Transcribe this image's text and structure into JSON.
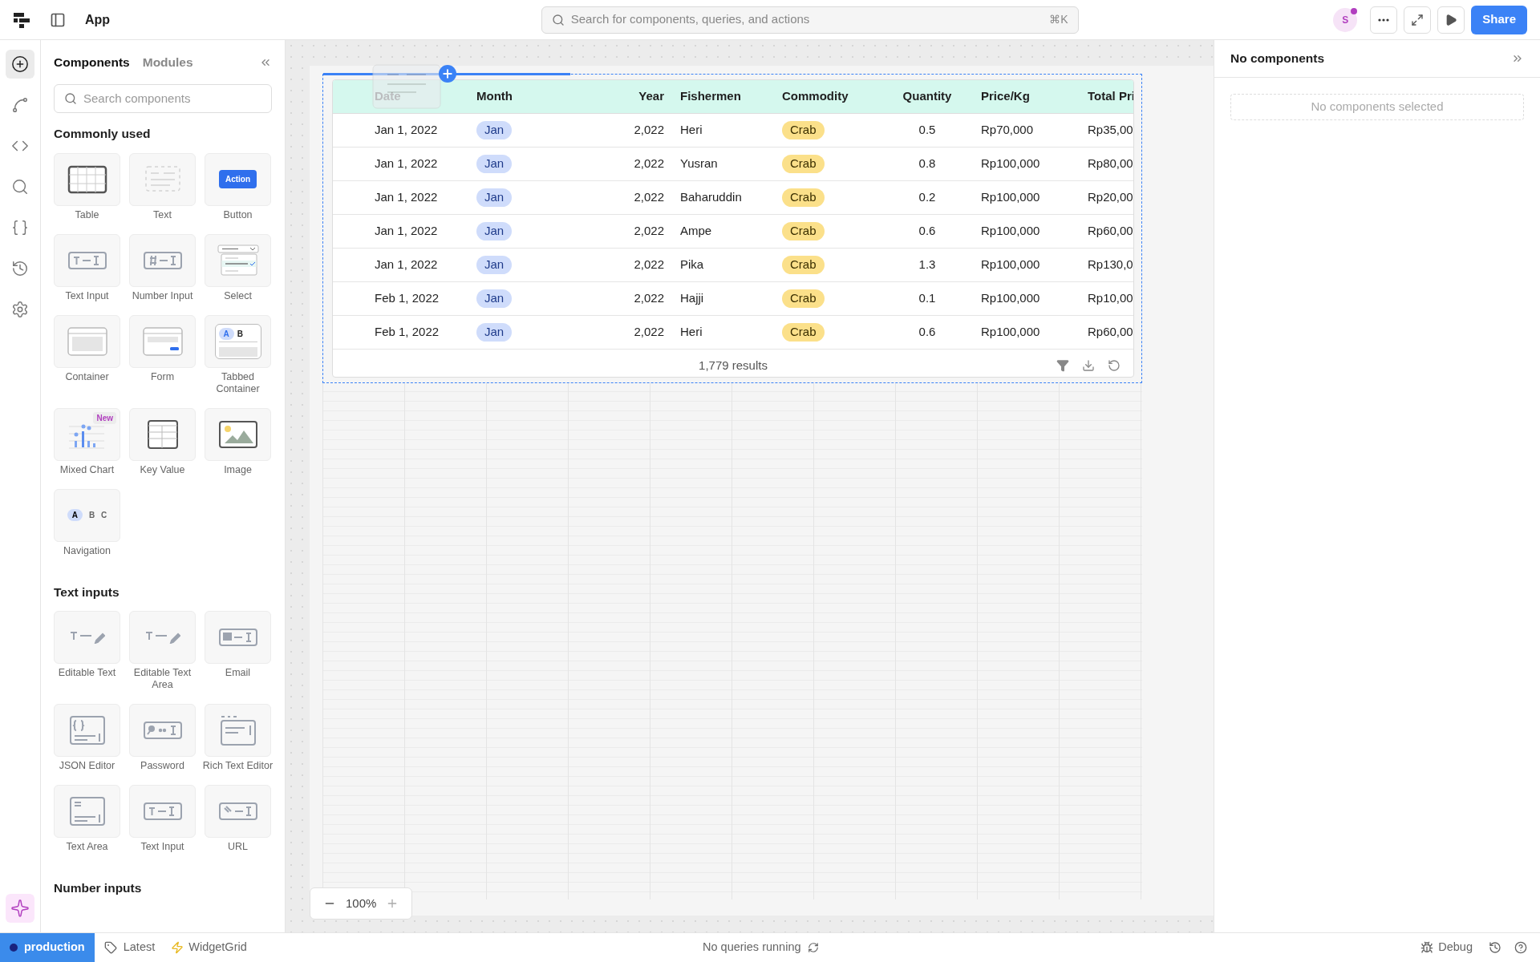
{
  "topbar": {
    "app_name": "App",
    "search": {
      "placeholder": "Search for components, queries, and actions",
      "shortcut": "⌘K"
    },
    "avatar": "S",
    "share": "Share"
  },
  "rail": [
    {
      "kind": "add",
      "selected": true
    },
    {
      "kind": "workflow",
      "selected": false
    },
    {
      "kind": "code",
      "selected": false
    },
    {
      "kind": "search",
      "selected": false
    },
    {
      "kind": "state",
      "selected": false
    },
    {
      "kind": "history",
      "selected": false
    },
    {
      "kind": "settings",
      "selected": false
    }
  ],
  "panel": {
    "tabs": [
      {
        "label": "Components",
        "selected": true
      },
      {
        "label": "Modules",
        "selected": false
      }
    ],
    "search": {
      "placeholder": "Search components"
    },
    "sections": [
      {
        "title": "Commonly used",
        "items": [
          {
            "label": "Table",
            "kind": "table"
          },
          {
            "label": "Text",
            "kind": "text"
          },
          {
            "label": "Button",
            "kind": "button",
            "preview": [
              "Action"
            ]
          },
          {
            "label": "Text Input",
            "kind": "text-input"
          },
          {
            "label": "Number Input",
            "kind": "number-input"
          },
          {
            "label": "Select",
            "kind": "select"
          },
          {
            "label": "Container",
            "kind": "container"
          },
          {
            "label": "Form",
            "kind": "form"
          },
          {
            "label": "Tabbed Container",
            "kind": "tabbed",
            "preview": [
              "A",
              "B"
            ]
          },
          {
            "label": "Mixed Chart",
            "kind": "chart",
            "badge": "New"
          },
          {
            "label": "Key Value",
            "kind": "key-value"
          },
          {
            "label": "Image",
            "kind": "image"
          },
          {
            "label": "Navigation",
            "kind": "navigation",
            "preview": [
              "A",
              "B",
              "C"
            ]
          }
        ]
      },
      {
        "title": "Text inputs",
        "items": [
          {
            "label": "Editable Text",
            "kind": "editable"
          },
          {
            "label": "Editable Text Area",
            "kind": "editable"
          },
          {
            "label": "Email",
            "kind": "email"
          },
          {
            "label": "JSON Editor",
            "kind": "json"
          },
          {
            "label": "Password",
            "kind": "password"
          },
          {
            "label": "Rich Text Editor",
            "kind": "rich"
          },
          {
            "label": "Text Area",
            "kind": "textarea"
          },
          {
            "label": "Text Input",
            "kind": "text-input"
          },
          {
            "label": "URL",
            "kind": "url"
          }
        ]
      },
      {
        "title": "Number inputs"
      }
    ]
  },
  "table": {
    "columns": [
      {
        "label": "Date",
        "kind": "text"
      },
      {
        "label": "Month",
        "kind": "month"
      },
      {
        "label": "Year",
        "kind": "number"
      },
      {
        "label": "Fishermen",
        "kind": "text"
      },
      {
        "label": "Commodity",
        "kind": "tag"
      },
      {
        "label": "Quantity",
        "kind": "center"
      },
      {
        "label": "Price/Kg",
        "kind": "text"
      },
      {
        "label": "Total Pri",
        "kind": "text"
      }
    ],
    "rows": [
      [
        "Jan 1, 2022",
        "Jan",
        "2,022",
        "Heri",
        "Crab",
        "0.5",
        "Rp70,000",
        "Rp35,00"
      ],
      [
        "Jan 1, 2022",
        "Jan",
        "2,022",
        "Yusran",
        "Crab",
        "0.8",
        "Rp100,000",
        "Rp80,00"
      ],
      [
        "Jan 1, 2022",
        "Jan",
        "2,022",
        "Baharuddin",
        "Crab",
        "0.2",
        "Rp100,000",
        "Rp20,00"
      ],
      [
        "Jan 1, 2022",
        "Jan",
        "2,022",
        "Ampe",
        "Crab",
        "0.6",
        "Rp100,000",
        "Rp60,00"
      ],
      [
        "Jan 1, 2022",
        "Jan",
        "2,022",
        "Pika",
        "Crab",
        "1.3",
        "Rp100,000",
        "Rp130,0"
      ],
      [
        "Feb 1, 2022",
        "Jan",
        "2,022",
        "Hajji",
        "Crab",
        "0.1",
        "Rp100,000",
        "Rp10,00"
      ],
      [
        "Feb 1, 2022",
        "Jan",
        "2,022",
        "Heri",
        "Crab",
        "0.6",
        "Rp100,000",
        "Rp60,00"
      ]
    ],
    "footer": "1,779 results"
  },
  "zoom": {
    "reading": "100%"
  },
  "right_panel": {
    "title": "No components",
    "empty": "No components selected"
  },
  "status_bar": {
    "environment": "production",
    "version": "Latest",
    "grid": "WidgetGrid",
    "queries": "No queries running",
    "debug": "Debug"
  }
}
